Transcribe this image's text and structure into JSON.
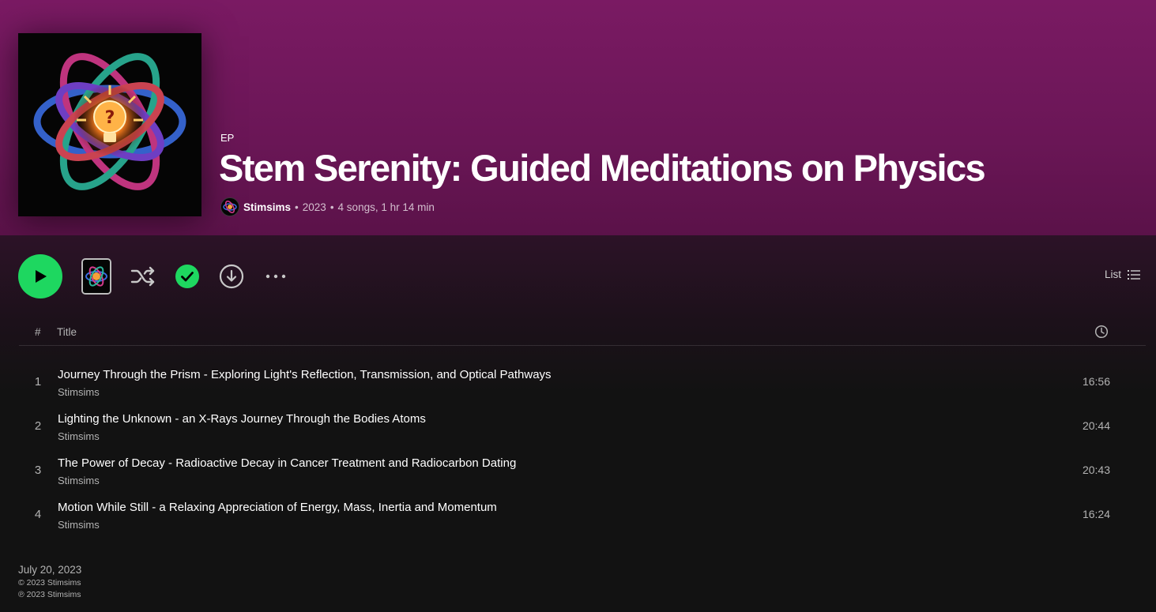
{
  "album": {
    "type": "EP",
    "title": "Stem Serenity: Guided Meditations on Physics",
    "artist": "Stimsims",
    "year": "2023",
    "summary": "4 songs, 1 hr 14 min",
    "separator": "•"
  },
  "controls": {
    "play_icon": "play-icon",
    "shuffle_icon": "shuffle-icon",
    "saved_icon": "check-circle-icon",
    "download_icon": "download-icon",
    "more_icon": "more-icon",
    "view_label": "List",
    "accent_color": "#1ed760"
  },
  "table": {
    "col_num": "#",
    "col_title": "Title",
    "col_duration_icon": "clock-icon"
  },
  "tracks": [
    {
      "num": "1",
      "title": "Journey Through the Prism - Exploring Light's Reflection, Transmission, and Optical Pathways",
      "artist": "Stimsims",
      "duration": "16:56"
    },
    {
      "num": "2",
      "title": "Lighting the Unknown - an X-Rays Journey Through the Bodies Atoms",
      "artist": "Stimsims",
      "duration": "20:44"
    },
    {
      "num": "3",
      "title": "The Power of Decay - Radioactive Decay in Cancer Treatment and Radiocarbon Dating",
      "artist": "Stimsims",
      "duration": "20:43"
    },
    {
      "num": "4",
      "title": "Motion While Still - a Relaxing Appreciation of Energy, Mass, Inertia and Momentum",
      "artist": "Stimsims",
      "duration": "16:24"
    }
  ],
  "footer": {
    "release_date": "July 20, 2023",
    "copyright": "© 2023 Stimsims",
    "phonographic": "℗ 2023 Stimsims"
  }
}
